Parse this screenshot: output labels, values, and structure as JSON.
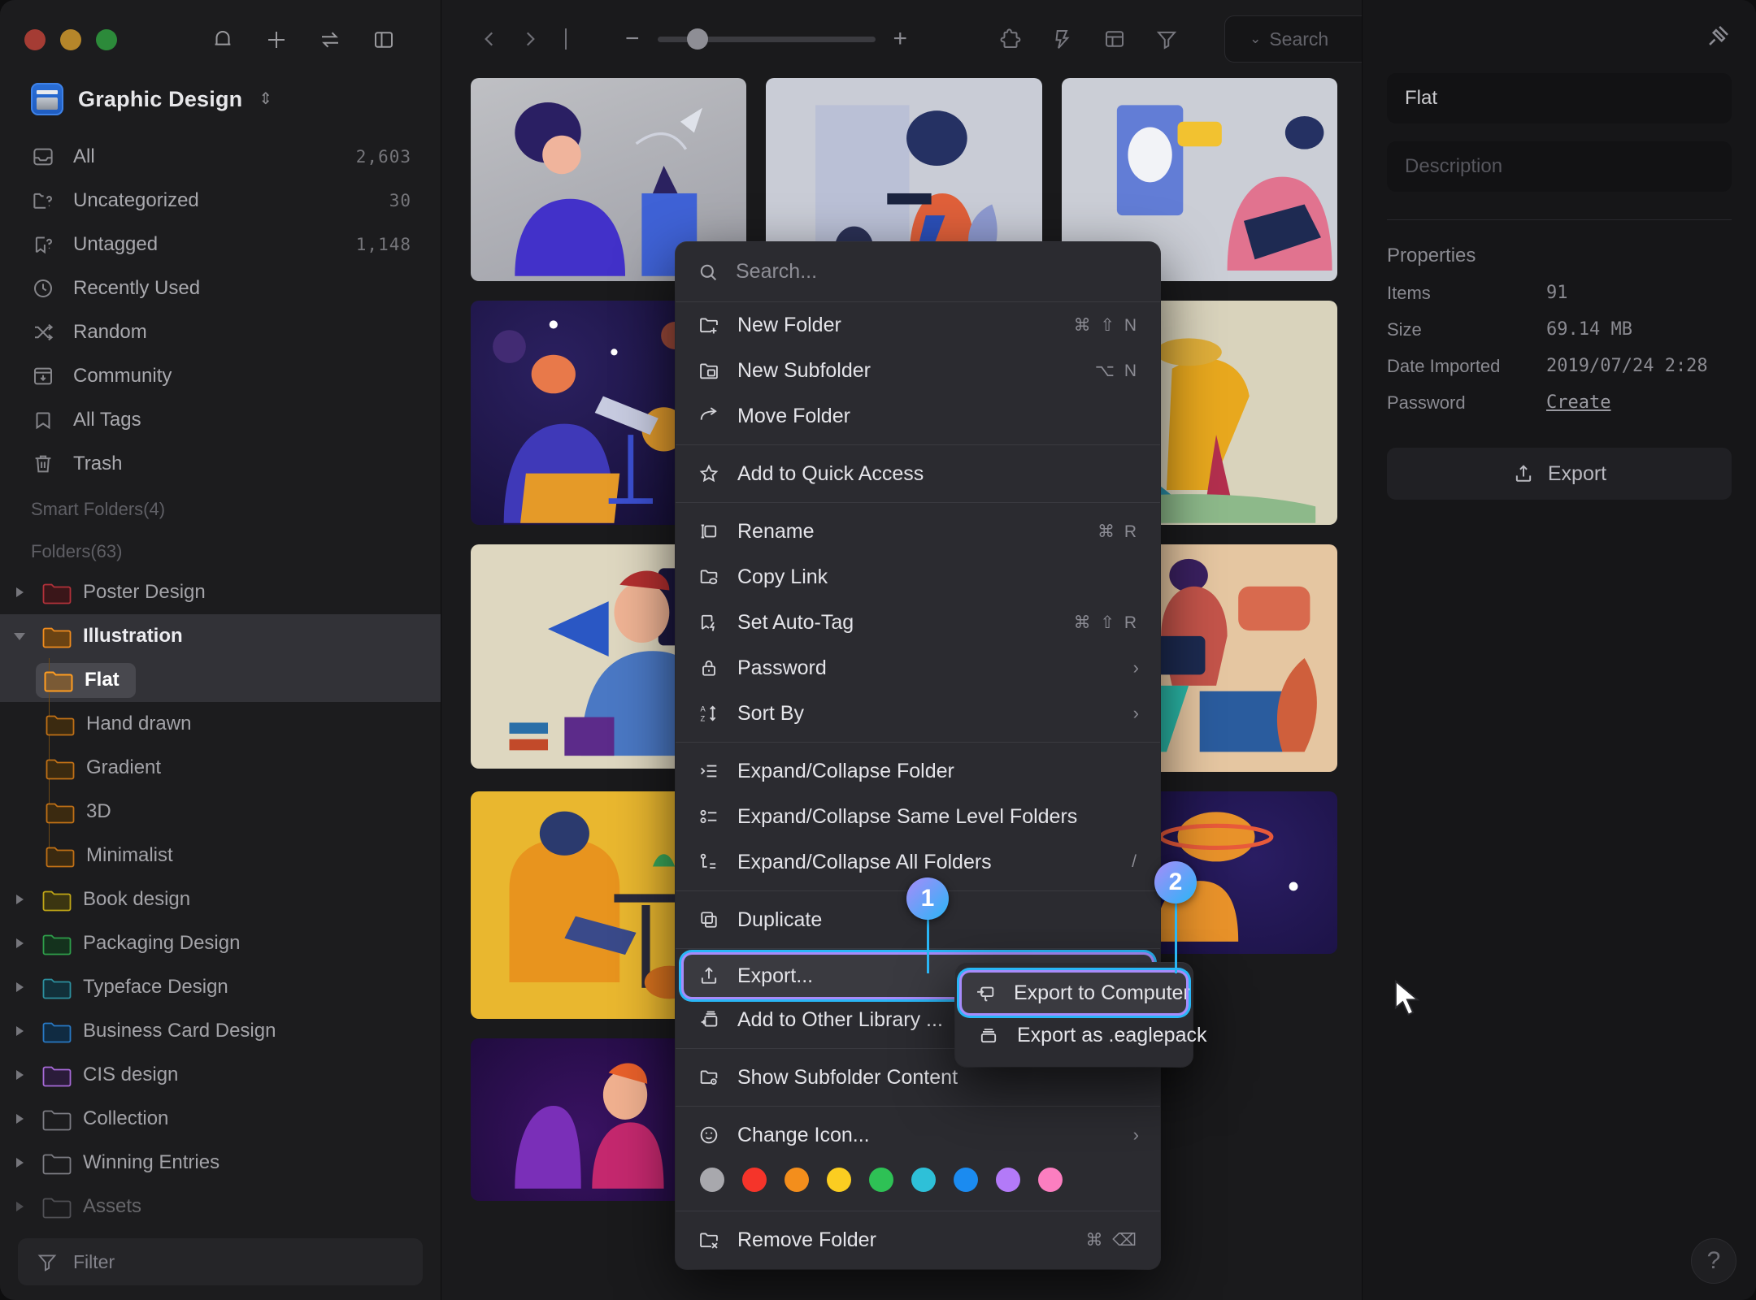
{
  "window": {
    "traffic_lights": [
      "close",
      "minimize",
      "maximize"
    ],
    "pin_icon": "pin-icon"
  },
  "sidebar": {
    "tools": [
      "bell-icon",
      "plus-icon",
      "sync-icon",
      "panel-toggle-icon"
    ],
    "library": {
      "name": "Graphic Design",
      "chevron": "⌄"
    },
    "nav": [
      {
        "icon": "inbox-icon",
        "label": "All",
        "count": "2,603"
      },
      {
        "icon": "folder-question-icon",
        "label": "Uncategorized",
        "count": "30"
      },
      {
        "icon": "tag-question-icon",
        "label": "Untagged",
        "count": "1,148"
      },
      {
        "icon": "clock-icon",
        "label": "Recently Used",
        "count": ""
      },
      {
        "icon": "shuffle-icon",
        "label": "Random",
        "count": ""
      },
      {
        "icon": "community-icon",
        "label": "Community",
        "count": ""
      },
      {
        "icon": "bookmark-icon",
        "label": "All Tags",
        "count": ""
      },
      {
        "icon": "trash-icon",
        "label": "Trash",
        "count": ""
      }
    ],
    "smart_folders_label": "Smart Folders(4)",
    "folders_label": "Folders(63)",
    "tree": [
      {
        "label": "Poster Design",
        "color": "#b2313a",
        "depth": 0,
        "caret": "closed",
        "selected": false
      },
      {
        "label": "Illustration",
        "color": "#f08c1e",
        "depth": 0,
        "caret": "open",
        "selected": false,
        "parent_highlight": true
      },
      {
        "label": "Flat",
        "color": "#ff9d21",
        "depth": 1,
        "caret": "none",
        "selected": true
      },
      {
        "label": "Hand drawn",
        "color": "#c07016",
        "depth": 1,
        "caret": "none",
        "selected": false
      },
      {
        "label": "Gradient",
        "color": "#c07016",
        "depth": 1,
        "caret": "none",
        "selected": false
      },
      {
        "label": "3D",
        "color": "#c07016",
        "depth": 1,
        "caret": "none",
        "selected": false
      },
      {
        "label": "Minimalist",
        "color": "#c07016",
        "depth": 1,
        "caret": "none",
        "selected": false
      },
      {
        "label": "Book design",
        "color": "#c0a617",
        "depth": 0,
        "caret": "closed",
        "selected": false
      },
      {
        "label": "Packaging Design",
        "color": "#2e9e4a",
        "depth": 0,
        "caret": "closed",
        "selected": false
      },
      {
        "label": "Typeface Design",
        "color": "#2c8f9e",
        "depth": 0,
        "caret": "closed",
        "selected": false
      },
      {
        "label": "Business Card Design",
        "color": "#2878c4",
        "depth": 0,
        "caret": "closed",
        "selected": false
      },
      {
        "label": "CIS design",
        "color": "#a76ad8",
        "depth": 0,
        "caret": "closed",
        "selected": false
      },
      {
        "label": "Collection",
        "color": "#7b7b82",
        "depth": 0,
        "caret": "closed",
        "selected": false
      },
      {
        "label": "Winning Entries",
        "color": "#7b7b82",
        "depth": 0,
        "caret": "closed",
        "selected": false
      },
      {
        "label": "Assets",
        "color": "#7b7b82",
        "depth": 0,
        "caret": "closed",
        "selected": false
      }
    ],
    "filter": {
      "label": "Filter",
      "icon": "filter-icon"
    }
  },
  "toolbar": {
    "back_icon": "chevron-left-icon",
    "forward_icon": "chevron-right-icon",
    "zoom_minus": "−",
    "zoom_plus": "+",
    "zoom_value": 14,
    "icons": [
      "puzzle-icon",
      "lightning-icon",
      "layout-icon",
      "filter-icon"
    ],
    "search": {
      "placeholder": "Search",
      "value": "",
      "icon": "search-icon",
      "chevron": "⌄"
    }
  },
  "context_menu": {
    "search_placeholder": "Search...",
    "groups": [
      [
        {
          "icon": "new-folder-icon",
          "label": "New Folder",
          "shortcut": "⌘ ⇧ N",
          "arrow": false
        },
        {
          "icon": "new-subfolder-icon",
          "label": "New Subfolder",
          "shortcut": "⌥ N",
          "arrow": false
        },
        {
          "icon": "move-folder-icon",
          "label": "Move Folder",
          "shortcut": "",
          "arrow": false
        }
      ],
      [
        {
          "icon": "star-icon",
          "label": "Add to Quick Access",
          "shortcut": "",
          "arrow": false
        }
      ],
      [
        {
          "icon": "rename-icon",
          "label": "Rename",
          "shortcut": "⌘ R",
          "arrow": false
        },
        {
          "icon": "copy-link-icon",
          "label": "Copy Link",
          "shortcut": "",
          "arrow": false
        },
        {
          "icon": "auto-tag-icon",
          "label": "Set Auto-Tag",
          "shortcut": "⌘ ⇧ R",
          "arrow": false
        },
        {
          "icon": "lock-icon",
          "label": "Password",
          "shortcut": "",
          "arrow": true
        },
        {
          "icon": "sort-icon",
          "label": "Sort By",
          "shortcut": "",
          "arrow": true
        }
      ],
      [
        {
          "icon": "expand-folder-icon",
          "label": "Expand/Collapse Folder",
          "shortcut": "",
          "arrow": false
        },
        {
          "icon": "expand-same-level-icon",
          "label": "Expand/Collapse Same Level Folders",
          "shortcut": "",
          "arrow": false
        },
        {
          "icon": "expand-all-icon",
          "label": "Expand/Collapse All Folders",
          "shortcut": "/",
          "arrow": false
        }
      ],
      [
        {
          "icon": "duplicate-icon",
          "label": "Duplicate",
          "shortcut": "",
          "arrow": false
        }
      ],
      [
        {
          "icon": "export-icon",
          "label": "Export...",
          "shortcut": "",
          "arrow": true,
          "highlighted": true
        },
        {
          "icon": "add-library-icon",
          "label": "Add to Other Library ...",
          "shortcut": "",
          "arrow": true
        }
      ],
      [
        {
          "icon": "show-subfolder-icon",
          "label": "Show Subfolder Content",
          "shortcut": "",
          "arrow": false
        }
      ],
      [
        {
          "icon": "smiley-icon",
          "label": "Change Icon...",
          "shortcut": "",
          "arrow": true
        }
      ]
    ],
    "swatches": [
      "#a8a8ad",
      "#f5342a",
      "#f38e1c",
      "#fbcd21",
      "#2ec155",
      "#2ec0d8",
      "#1b8bf0",
      "#b37af8",
      "#fb7ec0"
    ],
    "remove": {
      "icon": "remove-folder-icon",
      "label": "Remove Folder",
      "shortcut": "⌘ ⌫"
    }
  },
  "submenu": {
    "items": [
      {
        "icon": "export-computer-icon",
        "label": "Export to Computer",
        "highlighted": true
      },
      {
        "icon": "eaglepack-icon",
        "label": "Export as .eaglepack",
        "highlighted": false
      }
    ]
  },
  "callouts": [
    {
      "number": "1"
    },
    {
      "number": "2"
    }
  ],
  "inspector": {
    "name_value": "Flat",
    "description_placeholder": "Description",
    "properties_title": "Properties",
    "properties": [
      {
        "key": "Items",
        "value": "91",
        "link": false
      },
      {
        "key": "Size",
        "value": "69.14 MB",
        "link": false
      },
      {
        "key": "Date Imported",
        "value": "2019/07/24 2:28",
        "link": false
      },
      {
        "key": "Password",
        "value": "Create",
        "link": true
      }
    ],
    "export_button": "Export",
    "help_label": "?"
  },
  "grid": {
    "cards": [
      {
        "bg": "#b7b8bd",
        "h": "h1"
      },
      {
        "bg": "#c6cad6",
        "h": "h1"
      },
      {
        "bg": "#c8cbd4",
        "h": "h1"
      },
      {
        "bg": "#1b1340",
        "h": "h2"
      },
      {
        "bg": "#c9ccd2",
        "h": "h2"
      },
      {
        "bg": "#d6cfb8",
        "h": "h3"
      },
      {
        "bg": "#dcd5bd",
        "h": "h3"
      },
      {
        "bg": "#e0cfa6",
        "h": "h4"
      },
      {
        "bg": "#e2c3a0",
        "h": "h4"
      },
      {
        "bg": "#e8b42f",
        "h": "h4"
      },
      {
        "bg": "#e8b930",
        "h": "h4"
      },
      {
        "bg": "#1a1340",
        "h": "h5"
      },
      {
        "bg": "#2a1240",
        "h": "h5"
      }
    ]
  }
}
